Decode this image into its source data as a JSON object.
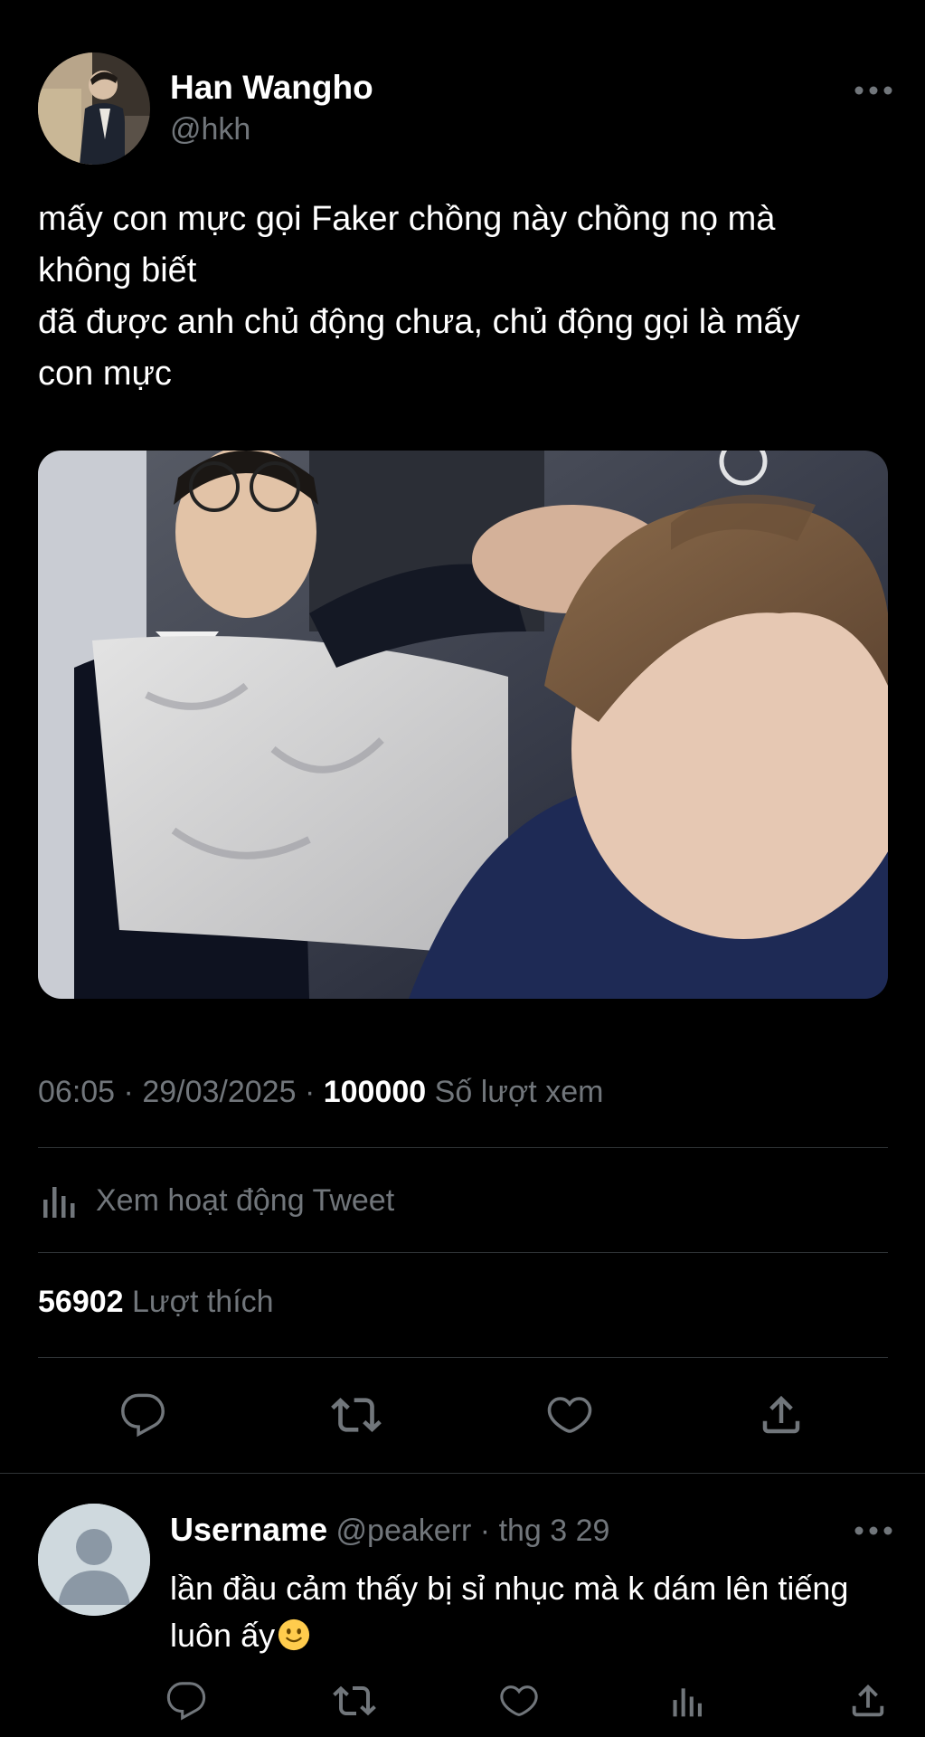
{
  "tweet": {
    "author_name": "Han Wangho",
    "author_handle": "@hkh",
    "avatar_icon": "user-avatar",
    "more_icon": "more-horizontal-icon",
    "text_lines": [
      "mấy con mực gọi Faker chồng này chồng nọ mà",
      "không biết",
      "đã được anh chủ động chưa, chủ động gọi là mấy",
      "con mực"
    ],
    "media_description_icon": "photo-thumbnail",
    "time": "06:05",
    "date": "29/03/2025",
    "separator": "·",
    "views_count": "100000",
    "views_label": "Số lượt xem",
    "activity_label": "Xem hoạt động Tweet",
    "activity_icon": "analytics-icon",
    "likes_count": "56902",
    "likes_label": "Lượt thích",
    "actions": [
      "reply-icon",
      "retweet-icon",
      "like-icon",
      "share-icon"
    ]
  },
  "reply": {
    "name": "Username",
    "handle": "@peakerr",
    "separator": "·",
    "date": "thg 3 29",
    "text_lines": [
      "lần đầu cảm thấy bị sỉ nhục mà k dám lên tiếng",
      "luôn ấy"
    ],
    "emoji_icon": "slightly-smiling-face-emoji",
    "actions": [
      "reply-icon",
      "retweet-icon",
      "like-icon",
      "analytics-icon",
      "share-icon"
    ]
  },
  "colors": {
    "background": "#000000",
    "text_primary": "#ffffff",
    "text_secondary": "#71767b",
    "divider": "#2f3336"
  }
}
